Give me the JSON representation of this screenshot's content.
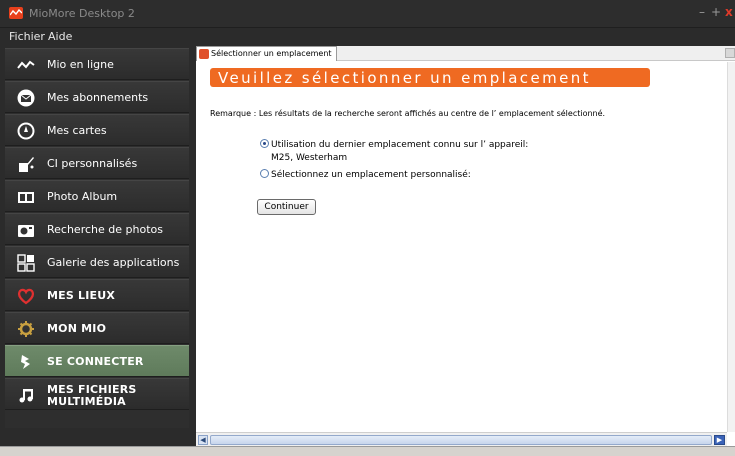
{
  "window": {
    "title": "MioMore Desktop 2",
    "controls": [
      "–",
      "+",
      "x"
    ]
  },
  "menu": {
    "items": [
      "Fichier",
      "Aide"
    ]
  },
  "sidebar": {
    "items": [
      {
        "label": "Mio en ligne",
        "icon": "signal-wave-icon"
      },
      {
        "label": "Mes abonnements",
        "icon": "envelope-icon"
      },
      {
        "label": "Mes cartes",
        "icon": "compass-icon"
      },
      {
        "label": "CI personnalisés",
        "icon": "brush-icon"
      },
      {
        "label": "Photo Album",
        "icon": "photo-album-icon"
      },
      {
        "label": "Recherche de photos",
        "icon": "camera-icon"
      },
      {
        "label": "Galerie des applications",
        "icon": "app-grid-icon"
      },
      {
        "label": "MES LIEUX",
        "icon": "heart-icon"
      },
      {
        "label": "MON MIO",
        "icon": "gear-icon"
      },
      {
        "label": "SE CONNECTER",
        "icon": "usb-plug-icon"
      },
      {
        "label": "MES FICHIERS MULTIMÉDIA",
        "line1": "MES FICHIERS",
        "line2": "MULTIMÉDIA",
        "icon": "music-note-icon"
      }
    ],
    "active_index": 9
  },
  "content": {
    "tab_label": "Sélectionner un emplacement",
    "heading": "Veuillez sélectionner un emplacement",
    "remark": "Remarque : Les résultats de la recherche seront affichés au centre de l’ emplacement sélectionné.",
    "options": [
      {
        "label": "Utilisation du dernier emplacement connu sur l’ appareil:",
        "checked": true
      },
      {
        "label": "Sélectionnez un emplacement personnalisé:",
        "checked": false
      }
    ],
    "last_location": "M25, Westerham",
    "continue_label": "Continuer"
  },
  "colors": {
    "accent": "#ef6a22",
    "active_nav": "#6a8666",
    "sidebar_bg": "#2e2e2e",
    "heart": "#e03030",
    "gear": "#c8a040"
  }
}
